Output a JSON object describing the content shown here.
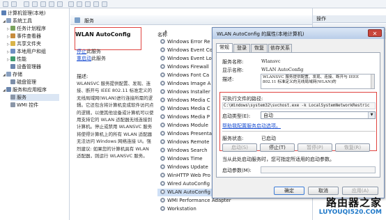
{
  "tree": {
    "items": [
      {
        "label": "计算机管理(本地)",
        "icon": "computer-icon",
        "color": "#5a7fb5"
      },
      {
        "label": "系统工具",
        "icon": "tools-icon",
        "color": "#8aa0bf"
      },
      {
        "label": "任务计划程序",
        "icon": "clock-icon",
        "color": "#7aa35c"
      },
      {
        "label": "事件查看器",
        "icon": "event-icon",
        "color": "#c78c3d"
      },
      {
        "label": "共享文件夹",
        "icon": "folder-icon",
        "color": "#d9b44a"
      },
      {
        "label": "本地用户和组",
        "icon": "users-icon",
        "color": "#6f8fc2"
      },
      {
        "label": "性能",
        "icon": "performance-icon",
        "color": "#3f9b6e"
      },
      {
        "label": "设备管理器",
        "icon": "device-icon",
        "color": "#6b86ad"
      },
      {
        "label": "存储",
        "icon": "storage-icon",
        "color": "#8aa0bf"
      },
      {
        "label": "磁盘管理",
        "icon": "disk-icon",
        "color": "#7d8ea8"
      },
      {
        "label": "服务和应用程序",
        "icon": "apps-icon",
        "color": "#6b86ad"
      },
      {
        "label": "服务",
        "icon": "services-icon",
        "color": "#8a96a8"
      },
      {
        "label": "WMI 控件",
        "icon": "wmi-icon",
        "color": "#8a96a8"
      }
    ]
  },
  "header": {
    "title": "服务"
  },
  "detail": {
    "service_title": "WLAN AutoConfig",
    "stop_text": "停止",
    "stop_suffix": "此服务",
    "restart_text": "重启动",
    "restart_suffix": "此服务",
    "desc_label": "描述:",
    "description": "WLANSVC 服务提供配置、发现、连接、断开与 IEEE 802.11 标准定义的无线局域网(WLAN)进行连接所需的逻辑。它还包含将计算机变成软件访问点的逻辑，以便其他设备或计算机可以使用支持它的 WLAN 适配器无线连接到计算机。停止或禁用 WLANSVC 服务将使得计算机上的所有 WLAN 适配器无法访问 Windows 网络连接 UI。强烈建议: 如果您的计算机具有 WLAN 适配器，则运行 WLANSVC 服务。"
  },
  "list": {
    "column_name": "名称",
    "services": [
      "Windows Error Re",
      "Windows Event Co",
      "Windows Event Lo",
      "Windows Firewall",
      "Windows Font Ca",
      "Windows Image A",
      "Windows Installer",
      "Windows Media C",
      "Windows Media C",
      "Windows Media P",
      "Windows Module",
      "Windows Presenta",
      "Windows Remote",
      "Windows Search",
      "Windows Time",
      "Windows Update",
      "WinHTTP Web Pro",
      "Wired AutoConfig",
      "WLAN AutoConfig",
      "WMI Performance Adapter",
      "Workstation"
    ],
    "selected_index": 18
  },
  "actions": {
    "title": "操作"
  },
  "dialog": {
    "title": "WLAN AutoConfig 的属性(本地计算机)",
    "close_glyph": "✕",
    "tabs": [
      "常规",
      "登录",
      "恢复",
      "依存关系"
    ],
    "service_name_label": "服务名称:",
    "service_name": "Wlansvc",
    "display_name_label": "显示名称:",
    "display_name": "WLAN AutoConfig",
    "desc_label": "描述:",
    "desc_text": "WLANSVC 服务提供配置、发现、连接、断开与 IEEE 802.11 标准定义的无线局域网(WLAN)的",
    "exe_path_label": "可执行文件的路径:",
    "exe_path": "C:\\Windows\\system32\\svchost.exe -k LocalSystemNetworkRestric",
    "startup_type_label": "启动类型(E):",
    "startup_type": "自动",
    "help_link": "帮助我配置服务启动选项。",
    "status_label": "服务状态:",
    "status_value": "已启动",
    "btn_start": "启动(S)",
    "btn_stop": "停止(T)",
    "btn_pause": "暂停(P)",
    "btn_resume": "恢复(R)",
    "params_note": "当从此处启动服务时，您可指定所适用的启动参数。",
    "params_label": "启动参数(M):",
    "btn_ok": "确定",
    "btn_cancel": "取消",
    "btn_apply": "应用(A)"
  },
  "watermark": {
    "main": "路由器之家",
    "sub": "LUYOUQI520.COM"
  },
  "colors": {
    "highlight": "#e0433f",
    "link": "#1a4ed1",
    "selection": "#cfe0f6"
  }
}
